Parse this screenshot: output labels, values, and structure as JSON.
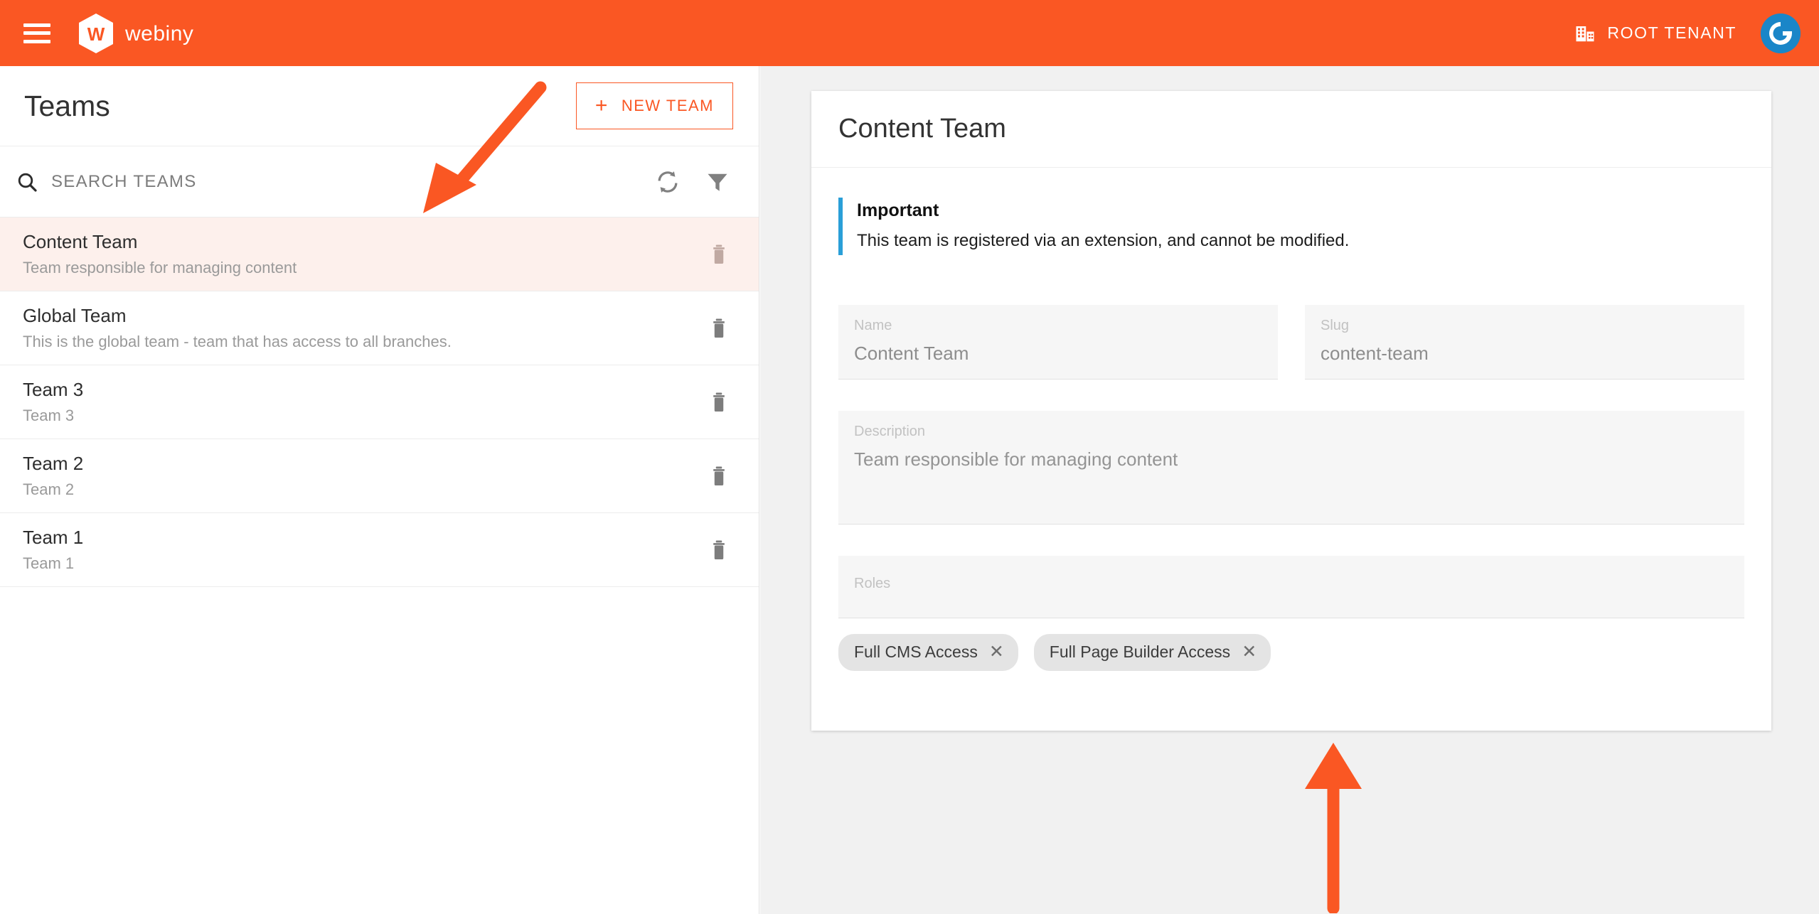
{
  "topbar": {
    "menu_icon": "hamburger-menu-icon",
    "brand_name": "webiny",
    "brand_mark_letter": "W",
    "tenant_icon": "building-icon",
    "tenant_label": "ROOT TENANT",
    "avatar_icon": "gravatar-avatar-icon",
    "background_color": "#fa5723"
  },
  "sidebar": {
    "title": "Teams",
    "new_team_button": {
      "label": "NEW TEAM",
      "plus": "+",
      "accent_color": "#fa5723"
    },
    "search": {
      "placeholder": "SEARCH TEAMS",
      "value": "",
      "icon": "search-icon"
    },
    "toolbar_icons": [
      {
        "name": "refresh-icon"
      },
      {
        "name": "filter-icon"
      }
    ],
    "selected_index": 0,
    "selected_background": "#fdf0ec",
    "teams": [
      {
        "name": "Content Team",
        "description": "Team responsible for managing content"
      },
      {
        "name": "Global Team",
        "description": "This is the global team - team that has access to all branches."
      },
      {
        "name": "Team 3",
        "description": "Team 3"
      },
      {
        "name": "Team 2",
        "description": "Team 2"
      },
      {
        "name": "Team 1",
        "description": "Team 1"
      }
    ],
    "row_action_icon": "trash-icon"
  },
  "detail": {
    "title": "Content Team",
    "callout": {
      "title": "Important",
      "text": "This team is registered via an extension, and cannot be modified.",
      "accent_color": "#2a9fd8"
    },
    "fields": {
      "name": {
        "label": "Name",
        "value": "Content Team"
      },
      "slug": {
        "label": "Slug",
        "value": "content-team"
      },
      "description": {
        "label": "Description",
        "value": "Team responsible for managing content"
      },
      "roles": {
        "label": "Roles",
        "value": ""
      }
    },
    "role_chips": [
      {
        "label": "Full CMS Access",
        "remove": "✕"
      },
      {
        "label": "Full Page Builder Access",
        "remove": "✕"
      }
    ]
  },
  "annotations": [
    {
      "name": "arrow-pointing-to-team-list",
      "direction": "down-left",
      "color": "#fa5723"
    },
    {
      "name": "arrow-pointing-to-detail-card-bottom",
      "direction": "up",
      "color": "#fa5723"
    }
  ]
}
